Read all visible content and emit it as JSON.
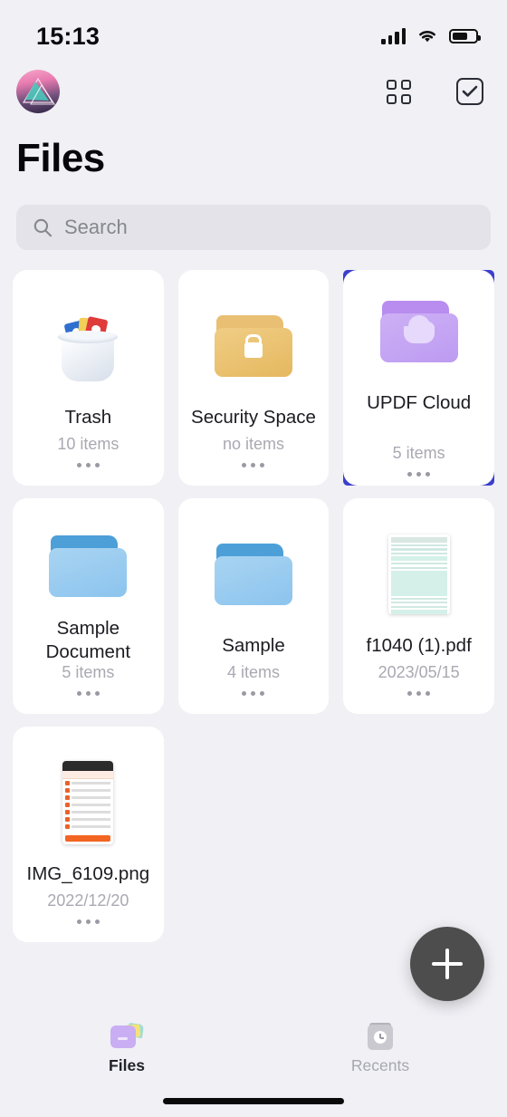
{
  "status_bar": {
    "time": "15:13",
    "signal_icon": "cellular-bars-icon",
    "wifi_icon": "wifi-icon",
    "battery_icon": "battery-icon"
  },
  "top_bar": {
    "avatar": "user-avatar",
    "grid_view_label": "grid-view-icon",
    "select_label": "select-mode-icon"
  },
  "header": {
    "title": "Files"
  },
  "search": {
    "placeholder": "Search",
    "value": "",
    "icon": "search-icon"
  },
  "selection": {
    "selected_item": "UPDF Cloud",
    "highlight_color": "#3b3fcc"
  },
  "files": [
    {
      "name": "Trash",
      "subtitle": "10 items",
      "icon": "trash-icon",
      "menu": "more-options"
    },
    {
      "name": "Security Space",
      "subtitle": "no items",
      "icon": "locked-folder-icon",
      "menu": "more-options"
    },
    {
      "name": "UPDF Cloud",
      "subtitle": "5 items",
      "icon": "cloud-folder-icon",
      "menu": "more-options"
    },
    {
      "name": "Sample Document",
      "subtitle": "5 items",
      "icon": "folder-icon",
      "menu": "more-options"
    },
    {
      "name": "Sample",
      "subtitle": "4 items",
      "icon": "folder-icon",
      "menu": "more-options"
    },
    {
      "name": "f1040 (1).pdf",
      "subtitle": "2023/05/15",
      "icon": "pdf-thumbnail",
      "menu": "more-options"
    },
    {
      "name": "IMG_6109.png",
      "subtitle": "2022/12/20",
      "icon": "image-thumbnail",
      "menu": "more-options"
    }
  ],
  "fab": {
    "label": "add-new",
    "icon": "plus-icon",
    "color": "#4d4d4d"
  },
  "tab_bar": {
    "tabs": [
      {
        "label": "Files",
        "icon": "files-icon",
        "active": true
      },
      {
        "label": "Recents",
        "icon": "recents-icon",
        "active": false
      }
    ]
  }
}
